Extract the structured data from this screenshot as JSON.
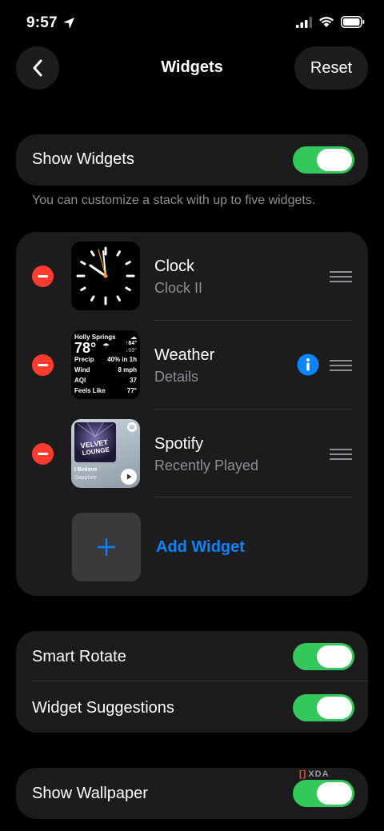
{
  "status": {
    "time": "9:57"
  },
  "nav": {
    "title": "Widgets",
    "reset_label": "Reset"
  },
  "show_widgets": {
    "label": "Show Widgets",
    "on": true,
    "hint": "You can customize a stack with up to five widgets."
  },
  "widgets": [
    {
      "name": "Clock",
      "subtitle": "Clock II",
      "icon": "clock-face"
    },
    {
      "name": "Weather",
      "subtitle": "Details",
      "icon": "weather-details",
      "preview": {
        "location": "Holly Springs",
        "temp": "78°",
        "high": "↑84°",
        "low": "↓69°",
        "rows": [
          {
            "label": "Precip",
            "value": "40% in 1h"
          },
          {
            "label": "Wind",
            "value": "8 mph"
          },
          {
            "label": "AQI",
            "value": "37"
          },
          {
            "label": "Feels Like",
            "value": "77°"
          }
        ]
      }
    },
    {
      "name": "Spotify",
      "subtitle": "Recently Played",
      "icon": "album-art",
      "preview": {
        "song": "I Believe",
        "artist": "Sapphire"
      }
    }
  ],
  "add_widget_label": "Add Widget",
  "toggles": [
    {
      "label": "Smart Rotate",
      "on": true
    },
    {
      "label": "Widget Suggestions",
      "on": true
    }
  ],
  "show_wallpaper": {
    "label": "Show Wallpaper",
    "on": true
  },
  "watermark": "XDA",
  "colors": {
    "accent": "#0a84ff",
    "toggle_on": "#34c759",
    "delete": "#ff3b30",
    "card": "#1c1c1e"
  }
}
